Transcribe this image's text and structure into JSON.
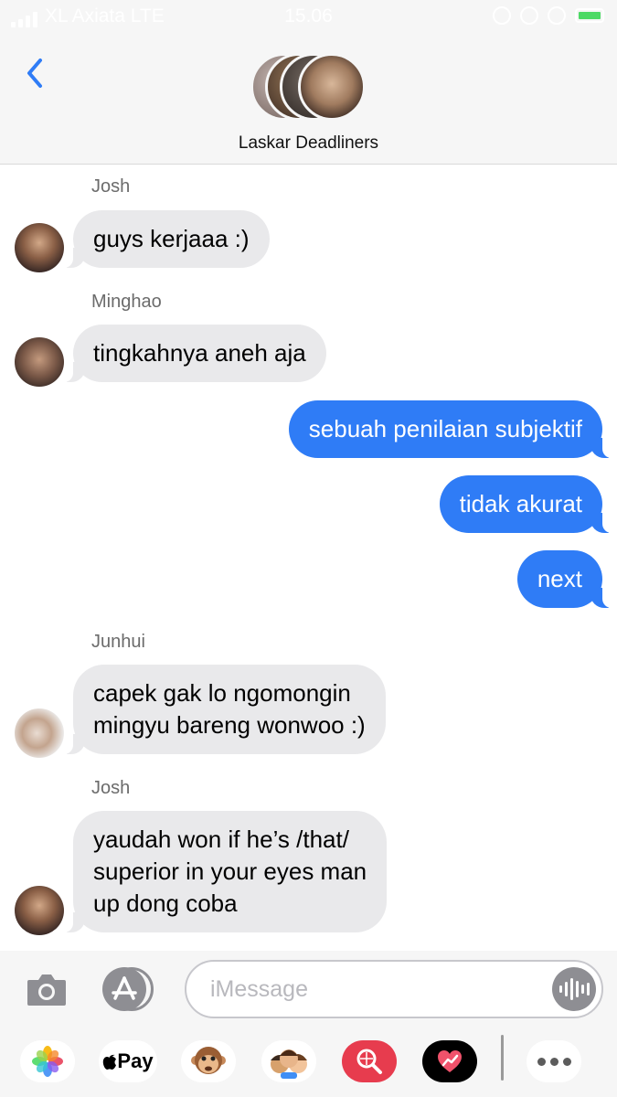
{
  "status_bar": {
    "carrier": "XL Axiata LTE",
    "time": "15.06"
  },
  "header": {
    "group_name": "Laskar Deadliners",
    "back_icon": "chevron-left-icon"
  },
  "messages": [
    {
      "sender": "Josh",
      "direction": "incoming",
      "text": "guys kerjaaa :)"
    },
    {
      "sender": "Minghao",
      "direction": "incoming",
      "text": "tingkahnya aneh aja"
    },
    {
      "direction": "outgoing",
      "text": "sebuah penilaian subjektif"
    },
    {
      "direction": "outgoing",
      "text": "tidak akurat"
    },
    {
      "direction": "outgoing",
      "text": "next"
    },
    {
      "sender": "Junhui",
      "direction": "incoming",
      "lines": [
        "capek gak lo ngomongin",
        "mingyu bareng wonwoo :)"
      ]
    },
    {
      "sender": "Josh",
      "direction": "incoming",
      "lines": [
        "yaudah won if he’s /that/",
        "superior in your eyes man",
        "up dong coba"
      ]
    }
  ],
  "input": {
    "placeholder": "iMessage"
  },
  "app_drawer": {
    "apple_pay_label": "Pay",
    "apps": [
      "photos-icon",
      "apple-pay-icon",
      "monkey-animoji-icon",
      "memoji-icon",
      "image-search-icon",
      "digital-touch-icon",
      "more-icon"
    ]
  },
  "colors": {
    "outgoing_bubble": "#2f7cf6",
    "incoming_bubble": "#e9e9eb",
    "accent": "#2f7cf6"
  }
}
